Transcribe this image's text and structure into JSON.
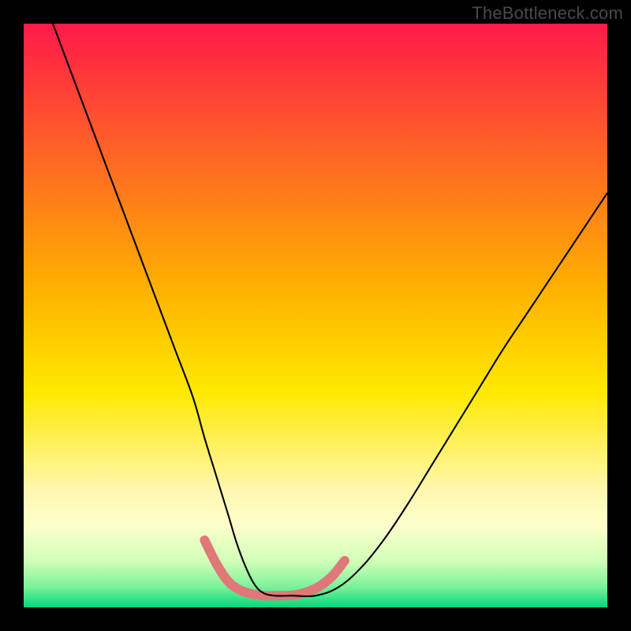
{
  "watermark": "TheBottleneck.com",
  "chart_data": {
    "type": "line",
    "title": "",
    "xlabel": "",
    "ylabel": "",
    "xlim": [
      0,
      100
    ],
    "ylim": [
      0,
      100
    ],
    "gradient": {
      "stops": [
        {
          "offset": 0.0,
          "color": "#ff1a4a"
        },
        {
          "offset": 0.45,
          "color": "#ffb000"
        },
        {
          "offset": 0.63,
          "color": "#ffe900"
        },
        {
          "offset": 0.8,
          "color": "#fff7b0"
        },
        {
          "offset": 0.86,
          "color": "#fcffcc"
        },
        {
          "offset": 0.92,
          "color": "#d1ffb8"
        },
        {
          "offset": 0.965,
          "color": "#7cf19b"
        },
        {
          "offset": 1.0,
          "color": "#00d97a"
        }
      ]
    },
    "series": [
      {
        "name": "bottleneck-curve",
        "color": "#000000",
        "width": 2.1,
        "x": [
          5,
          8,
          11,
          14,
          17,
          20,
          23,
          26,
          29,
          31,
          33,
          35,
          36.5,
          38,
          39.5,
          41,
          43,
          46,
          50,
          54,
          58,
          62,
          66,
          70,
          74,
          78,
          82,
          86,
          90,
          94,
          98,
          100
        ],
        "y": [
          100,
          92,
          84,
          76,
          68,
          60,
          52,
          44,
          36,
          29,
          22.5,
          16,
          11,
          7,
          4,
          2.5,
          2,
          2,
          2.0,
          3.5,
          7,
          12,
          18,
          24.5,
          31,
          37.5,
          44,
          50,
          56,
          62,
          68,
          71
        ]
      },
      {
        "name": "optimal-range-marker",
        "color": "#e07878",
        "width": 12,
        "linecap": "round",
        "x": [
          31,
          33,
          35,
          37,
          39,
          41,
          43,
          45,
          47,
          49,
          51,
          53,
          55
        ],
        "y": [
          11.5,
          7.5,
          4.5,
          3.0,
          2.3,
          2.0,
          2.0,
          2.0,
          2.2,
          2.8,
          3.8,
          5.5,
          8.0
        ]
      }
    ]
  }
}
